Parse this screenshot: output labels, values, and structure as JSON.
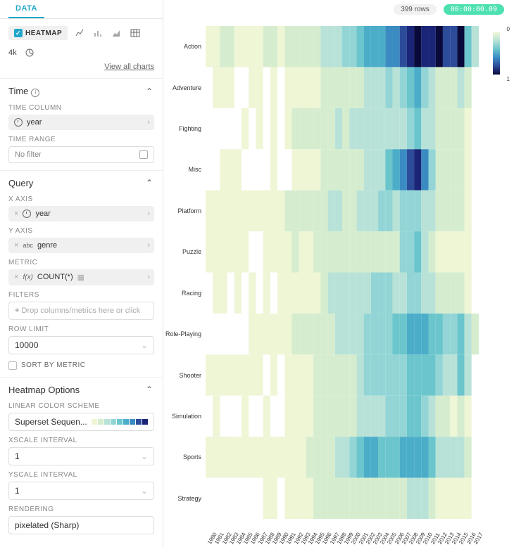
{
  "tab_label": "DATA",
  "viz": {
    "selected": "HEATMAP",
    "alt": "4k",
    "view_all": "View all charts"
  },
  "time": {
    "section": "Time",
    "col_label": "TIME COLUMN",
    "col_value": "year",
    "range_label": "TIME RANGE",
    "range_placeholder": "No filter"
  },
  "query": {
    "section": "Query",
    "x_label": "X AXIS",
    "x_value": "year",
    "y_label": "Y AXIS",
    "y_value": "genre",
    "metric_label": "METRIC",
    "metric_value": "COUNT(*)",
    "filters_label": "FILTERS",
    "filters_placeholder": "Drop columns/metrics here or click",
    "rowlimit_label": "ROW LIMIT",
    "rowlimit_value": "10000",
    "sortby_label": "SORT BY METRIC"
  },
  "heatmap_opts": {
    "section": "Heatmap Options",
    "scheme_label": "LINEAR COLOR SCHEME",
    "scheme_value": "Superset Sequen...",
    "xscale_label": "XSCALE INTERVAL",
    "xscale_value": "1",
    "yscale_label": "YSCALE INTERVAL",
    "yscale_value": "1",
    "rendering_label": "RENDERING",
    "rendering_value": "pixelated (Sharp)"
  },
  "header": {
    "rowcount": "399 rows",
    "timer": "00:00:00.09"
  },
  "swatches": [
    "#eef6d6",
    "#d5edce",
    "#b8e2d7",
    "#93d5d6",
    "#6bc5cc",
    "#4cadc9",
    "#3a8bc2",
    "#2c4b99",
    "#1a2577",
    "#0a0a3a"
  ],
  "legend": {
    "top": "0",
    "bottom": "1"
  },
  "chart_data": {
    "type": "heatmap",
    "xlabel": "year",
    "ylabel": "genre",
    "metric": "COUNT(*)",
    "x": [
      "1980",
      "1981",
      "1982",
      "1983",
      "1984",
      "1985",
      "1986",
      "1987",
      "1988",
      "1989",
      "1990",
      "1991",
      "1992",
      "1993",
      "1994",
      "1995",
      "1996",
      "1997",
      "1998",
      "1999",
      "2000",
      "2001",
      "2002",
      "2003",
      "2004",
      "2005",
      "2006",
      "2007",
      "2008",
      "2009",
      "2010",
      "2011",
      "2012",
      "2013",
      "2014",
      "2015",
      "2016",
      "2017"
    ],
    "y": [
      "Action",
      "Adventure",
      "Fighting",
      "Misc",
      "Platform",
      "Puzzle",
      "Racing",
      "Role-Playing",
      "Shooter",
      "Simulation",
      "Sports",
      "Strategy"
    ],
    "values": [
      [
        0.05,
        0.08,
        0.1,
        0.1,
        0.08,
        0.08,
        0.08,
        0.08,
        0.1,
        0.1,
        0.08,
        0.1,
        0.12,
        0.12,
        0.15,
        0.15,
        0.2,
        0.28,
        0.28,
        0.3,
        0.35,
        0.42,
        0.5,
        0.55,
        0.58,
        0.6,
        0.62,
        0.7,
        0.8,
        0.95,
        0.8,
        0.85,
        1.0,
        0.75,
        0.75,
        0.9,
        0.45,
        0.2
      ],
      [
        null,
        0.03,
        0.05,
        0.05,
        null,
        null,
        0.03,
        0.05,
        null,
        0.05,
        null,
        0.06,
        0.08,
        0.05,
        0.08,
        0.08,
        0.1,
        0.12,
        0.18,
        0.15,
        0.12,
        0.15,
        0.22,
        0.2,
        0.25,
        0.3,
        0.28,
        0.35,
        0.45,
        0.5,
        0.35,
        0.28,
        0.18,
        0.15,
        0.15,
        0.2,
        0.1,
        null
      ],
      [
        null,
        null,
        null,
        null,
        null,
        0.02,
        null,
        0.05,
        null,
        0.05,
        null,
        0.06,
        0.1,
        0.1,
        0.1,
        0.12,
        0.15,
        0.15,
        0.2,
        0.18,
        0.2,
        0.2,
        0.22,
        0.22,
        0.2,
        0.2,
        0.2,
        0.22,
        0.35,
        0.4,
        0.25,
        0.22,
        0.15,
        0.12,
        0.12,
        0.15,
        0.08,
        null
      ],
      [
        null,
        null,
        0.02,
        0.02,
        0.02,
        null,
        null,
        null,
        null,
        0.02,
        null,
        null,
        0.05,
        0.03,
        0.05,
        0.08,
        0.12,
        0.1,
        0.12,
        0.15,
        0.15,
        0.15,
        0.2,
        0.25,
        0.28,
        0.4,
        0.5,
        0.6,
        0.7,
        0.8,
        0.6,
        0.35,
        0.18,
        0.15,
        0.12,
        0.12,
        0.08,
        null
      ],
      [
        0.03,
        0.05,
        0.08,
        0.08,
        0.05,
        0.05,
        0.05,
        0.05,
        0.08,
        0.08,
        0.08,
        0.1,
        0.1,
        0.1,
        0.12,
        0.15,
        0.15,
        0.2,
        0.22,
        0.18,
        0.18,
        0.22,
        0.28,
        0.28,
        0.3,
        0.3,
        0.25,
        0.3,
        0.35,
        0.35,
        0.25,
        0.25,
        0.12,
        0.12,
        0.1,
        0.1,
        0.05,
        null
      ],
      [
        0.02,
        0.03,
        0.05,
        0.05,
        0.03,
        0.05,
        null,
        null,
        0.05,
        0.08,
        0.05,
        0.08,
        0.1,
        0.08,
        0.08,
        0.1,
        0.1,
        0.1,
        0.1,
        0.1,
        0.1,
        0.12,
        0.1,
        0.1,
        0.12,
        0.15,
        0.15,
        0.3,
        0.35,
        0.4,
        0.22,
        0.12,
        0.05,
        0.05,
        0.05,
        0.05,
        0.03,
        null
      ],
      [
        null,
        0.02,
        0.05,
        null,
        0.03,
        null,
        0.03,
        null,
        0.05,
        null,
        0.05,
        0.05,
        0.05,
        0.05,
        0.05,
        0.08,
        0.15,
        0.2,
        0.22,
        0.2,
        0.25,
        0.28,
        0.28,
        0.35,
        0.3,
        0.3,
        0.28,
        0.28,
        0.35,
        0.35,
        0.25,
        0.25,
        0.12,
        0.1,
        0.1,
        0.1,
        0.05,
        null
      ],
      [
        null,
        null,
        null,
        null,
        null,
        null,
        0.02,
        0.05,
        0.05,
        0.05,
        0.05,
        0.08,
        0.1,
        0.1,
        0.1,
        0.12,
        0.18,
        0.18,
        0.2,
        0.22,
        0.22,
        0.22,
        0.3,
        0.3,
        0.35,
        0.35,
        0.4,
        0.4,
        0.5,
        0.5,
        0.5,
        0.45,
        0.4,
        0.3,
        0.3,
        0.4,
        0.25,
        0.1
      ],
      [
        0.05,
        0.05,
        0.05,
        0.05,
        0.05,
        0.05,
        0.03,
        0.05,
        null,
        0.05,
        null,
        0.05,
        0.05,
        0.05,
        0.08,
        0.15,
        0.15,
        0.15,
        0.15,
        0.15,
        0.15,
        0.2,
        0.35,
        0.3,
        0.35,
        0.35,
        0.3,
        0.3,
        0.4,
        0.4,
        0.4,
        0.45,
        0.3,
        0.25,
        0.25,
        0.4,
        0.25,
        null
      ],
      [
        null,
        0.02,
        null,
        null,
        null,
        0.02,
        null,
        null,
        0.03,
        null,
        null,
        0.05,
        0.05,
        0.05,
        0.05,
        0.12,
        0.15,
        0.12,
        0.15,
        0.15,
        0.15,
        0.22,
        0.22,
        0.25,
        0.22,
        0.3,
        0.3,
        0.3,
        0.45,
        0.45,
        0.35,
        0.25,
        0.15,
        0.1,
        0.08,
        0.12,
        0.05,
        null
      ],
      [
        0.03,
        0.05,
        0.05,
        0.05,
        0.03,
        0.03,
        0.05,
        0.05,
        0.05,
        0.08,
        0.05,
        0.08,
        0.08,
        0.05,
        0.1,
        0.12,
        0.18,
        0.18,
        0.2,
        0.2,
        0.3,
        0.4,
        0.55,
        0.5,
        0.45,
        0.4,
        0.45,
        0.5,
        0.55,
        0.55,
        0.5,
        0.45,
        0.25,
        0.2,
        0.2,
        0.25,
        0.18,
        null
      ],
      [
        null,
        null,
        null,
        null,
        null,
        null,
        null,
        null,
        0.02,
        0.02,
        null,
        0.05,
        0.05,
        0.05,
        0.08,
        0.12,
        0.12,
        0.12,
        0.12,
        0.12,
        0.15,
        0.15,
        0.12,
        0.15,
        0.15,
        0.15,
        0.15,
        0.18,
        0.2,
        0.25,
        0.2,
        0.15,
        0.08,
        0.08,
        0.05,
        0.08,
        0.05,
        null
      ]
    ],
    "colorscale": [
      "#eef6d6",
      "#d5edce",
      "#b8e2d7",
      "#93d5d6",
      "#6bc5cc",
      "#4cadc9",
      "#3a8bc2",
      "#2c4b99",
      "#1a2577",
      "#0a0a3a"
    ]
  }
}
